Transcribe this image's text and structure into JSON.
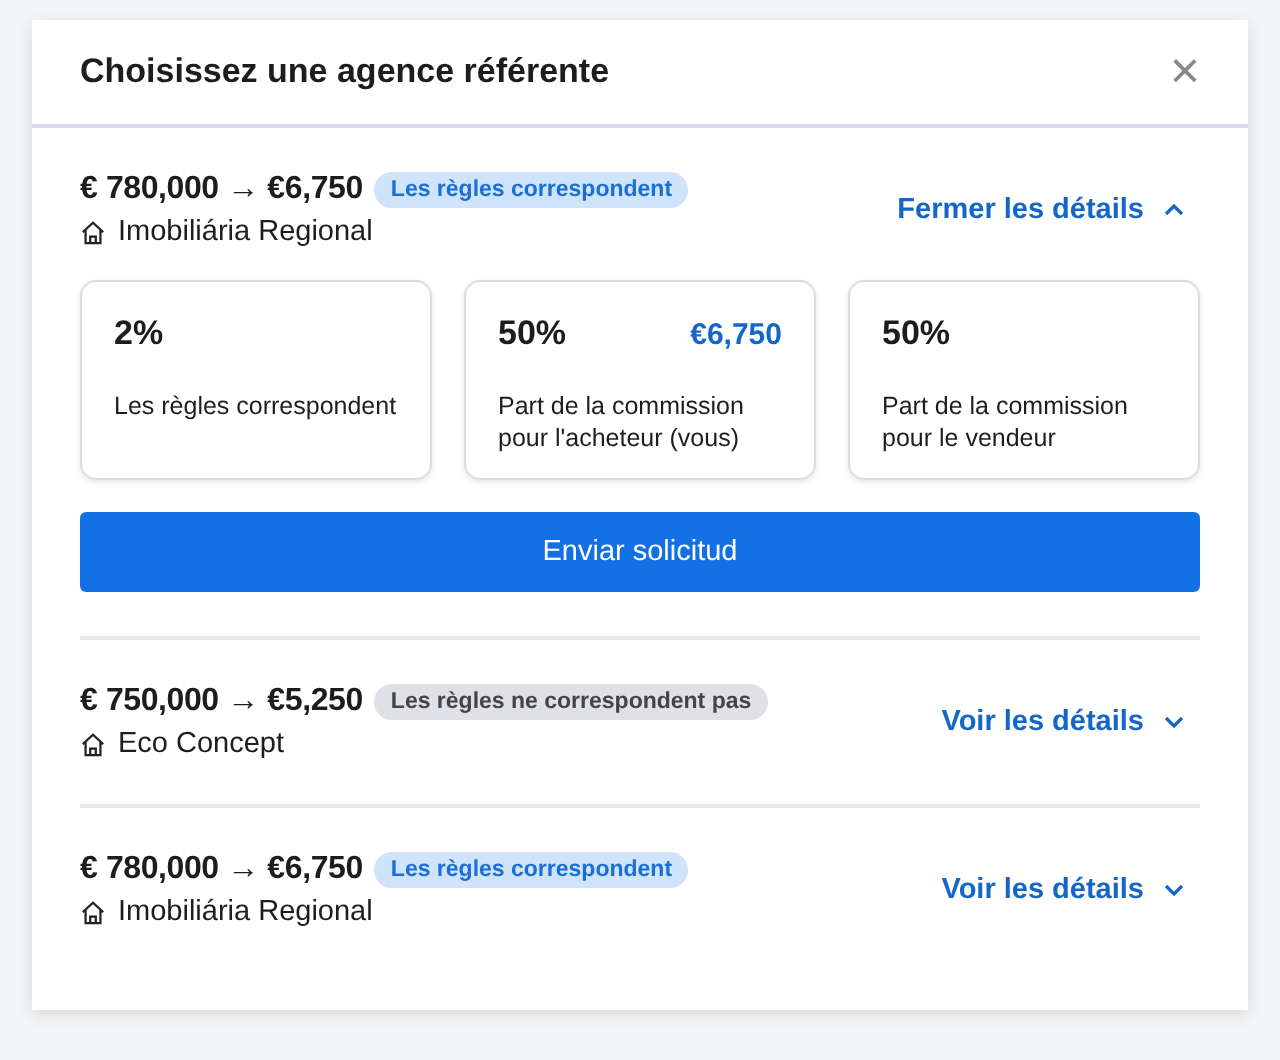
{
  "dialog": {
    "title": "Choisissez une agence référente",
    "close_label": "×"
  },
  "agencies": [
    {
      "amount": "€ 780,000 → €6,750",
      "badge": {
        "label": "Les règles correspondent",
        "kind": "match"
      },
      "name": "Imobiliária Regional",
      "toggle": "Fermer les détails",
      "expanded": true,
      "cards": [
        {
          "value": "2%",
          "label": "Les règles correspondent"
        },
        {
          "value": "50%",
          "amount": "€6,750",
          "label": "Part de la commission pour l'acheteur (vous)"
        },
        {
          "value": "50%",
          "label": "Part de la commission pour le vendeur"
        }
      ],
      "button": "Enviar solicitud"
    },
    {
      "amount": "€ 750,000 → €5,250",
      "badge": {
        "label": "Les règles ne correspondent pas",
        "kind": "nomatch"
      },
      "name": "Eco Concept",
      "toggle": "Voir les détails",
      "expanded": false
    },
    {
      "amount": "€ 780,000 → €6,750",
      "badge": {
        "label": "Les règles correspondent",
        "kind": "match"
      },
      "name": "Imobiliária Regional",
      "toggle": "Voir les détails",
      "expanded": false
    }
  ]
}
